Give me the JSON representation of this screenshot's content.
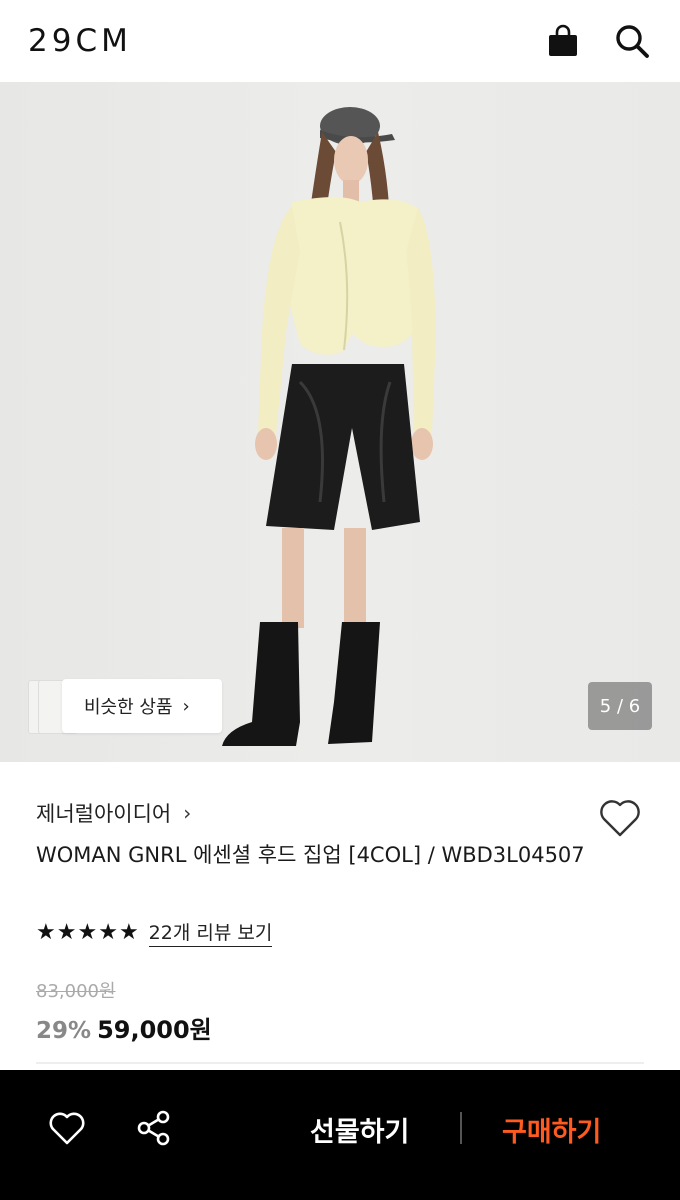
{
  "header": {
    "logo": "29CM",
    "icons": [
      "shopping-bag-icon",
      "search-icon"
    ]
  },
  "gallery": {
    "similar_label": "비슷한 상품",
    "similar_chevron": "›",
    "counter": "5 / 6"
  },
  "product": {
    "brand": "제너럴아이디어",
    "brand_chevron": "›",
    "title": "WOMAN GNRL 에센셜 후드 집업 [4COL] / WBD3L04507",
    "rating_stars": 5,
    "review_link": "22개 리뷰 보기",
    "original_price": "83,000원",
    "discount": "29%",
    "price": "59,000원"
  },
  "bottom_bar": {
    "gift_label": "선물하기",
    "buy_label": "구매하기",
    "buy_color": "#ff5a1f"
  }
}
